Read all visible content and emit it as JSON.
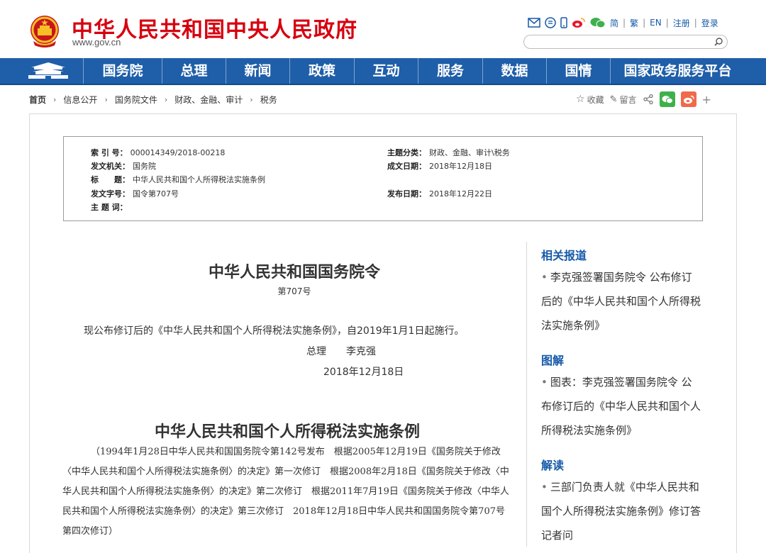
{
  "header": {
    "site_title": "中华人民共和国中央人民政府",
    "site_domain": "www.gov.cn",
    "lang_simplified": "简",
    "lang_traditional": "繁",
    "lang_en": "EN",
    "register": "注册",
    "login": "登录",
    "search_placeholder": "",
    "icons": [
      "mail-icon",
      "message-icon",
      "mobile-icon",
      "weibo-icon",
      "wechat-icon",
      "search-icon"
    ]
  },
  "nav": {
    "items": [
      "国务院",
      "总理",
      "新闻",
      "政策",
      "互动",
      "服务",
      "数据",
      "国情",
      "国家政务服务平台"
    ]
  },
  "breadcrumb": {
    "items": [
      "首页",
      "信息公开",
      "国务院文件",
      "财政、金融、审计",
      "税务"
    ]
  },
  "share": {
    "favorite": "收藏",
    "comment": "留言",
    "more": "+"
  },
  "meta": {
    "index_label": "索 引 号：",
    "index_value": "000014349/2018-00218",
    "issuer_label": "发文机关：",
    "issuer_value": "国务院",
    "title_label": "标　　题：",
    "title_value": "中华人民共和国个人所得税法实施条例",
    "docno_label": "发文字号：",
    "docno_value": "国令第707号",
    "keywords_label": "主 题 词：",
    "keywords_value": "",
    "category_label": "主题分类：",
    "category_value": "财政、金融、审计\\税务",
    "created_label": "成文日期：",
    "created_value": "2018年12月18日",
    "published_label": "发布日期：",
    "published_value": "2018年12月22日"
  },
  "article": {
    "order_title": "中华人民共和国国务院令",
    "order_number": "第707号",
    "announcement": "现公布修订后的《中华人民共和国个人所得税法实施条例》，自2019年1月1日起施行。",
    "signer_title": "总理",
    "signer_name": "李克强",
    "sign_date": "2018年12月18日",
    "regulation_title": "中华人民共和国个人所得税法实施条例",
    "regulation_note": "（1994年1月28日中华人民共和国国务院令第142号发布　根据2005年12月19日《国务院关于修改〈中华人民共和国个人所得税法实施条例〉的决定》第一次修订　根据2008年2月18日《国务院关于修改〈中华人民共和国个人所得税法实施条例〉的决定》第二次修订　根据2011年7月19日《国务院关于修改〈中华人民共和国个人所得税法实施条例〉的决定》第三次修订　2018年12月18日中华人民共和国国务院令第707号第四次修订）"
  },
  "sidebar": {
    "related_head": "相关报道",
    "related_items": [
      "李克强签署国务院令 公布修订后的《中华人民共和国个人所得税法实施条例》"
    ],
    "graphic_head": "图解",
    "graphic_items": [
      "图表：李克强签署国务院令 公布修订后的《中华人民共和国个人所得税法实施条例》"
    ],
    "reading_head": "解读",
    "reading_items": [
      "三部门负责人就《中华人民共和国个人所得税法实施条例》修订答记者问"
    ]
  },
  "colors": {
    "brand_red": "#d7000f",
    "nav_blue": "#1f5ea8",
    "link_blue": "#1659a8",
    "wechat_green": "#3fb14b",
    "weibo_orange": "#f0694a"
  }
}
